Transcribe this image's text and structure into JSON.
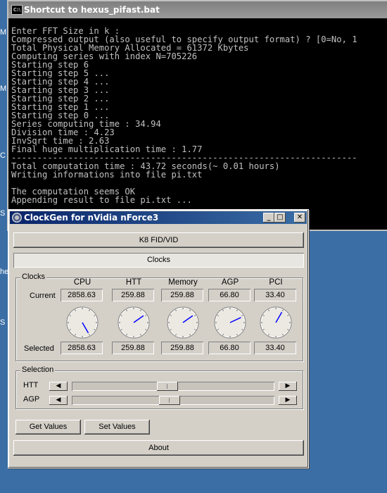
{
  "console": {
    "title": "Shortcut to hexus_pifast.bat",
    "icon_text": "C:\\",
    "lines": [
      "Enter FFT Size in k :",
      "Compressed output (also useful to specify output format) ? [0=No, 1",
      "Total Physical Memory Allocated = 61372 Kbytes",
      "Computing series with index N=705226",
      "Starting step 6",
      "Starting step 5 ...",
      "Starting step 4 ...",
      "Starting step 3 ...",
      "Starting step 2 ...",
      "Starting step 1 ...",
      "Starting step 0 ...",
      "Series computing time : 34.94",
      "Division time : 4.23",
      "InvSqrt time : 2.63",
      "Final huge multiplication time : 1.77",
      "-------------------------------------------------------------------",
      "Total computation time : 43.72 seconds(~ 0.01 hours)",
      "Writing informations into file pi.txt",
      "",
      "The computation seems OK",
      "Appending result to file pi.txt ..."
    ]
  },
  "clockgen": {
    "title": "ClockGen for nVidia nForce3",
    "buttons": {
      "minimize": "_",
      "maximize": "□",
      "close": "✕"
    },
    "tabs": [
      "K8 FID/VID",
      "Clocks"
    ],
    "clocks_group": "Clocks",
    "row_labels": {
      "current": "Current",
      "selected": "Selected"
    },
    "columns": [
      {
        "name": "CPU",
        "current": "2858.63",
        "selected": "2858.63"
      },
      {
        "name": "HTT",
        "current": "259.88",
        "selected": "259.88"
      },
      {
        "name": "Memory",
        "current": "259.88",
        "selected": "259.88"
      },
      {
        "name": "AGP",
        "current": "66.80",
        "selected": "66.80"
      },
      {
        "name": "PCI",
        "current": "33.40",
        "selected": "33.40"
      }
    ],
    "selection_group": "Selection",
    "sliders": [
      {
        "label": "HTT",
        "position": 0.42
      },
      {
        "label": "AGP",
        "position": 0.43
      }
    ],
    "get_values": "Get Values",
    "set_values": "Set Values",
    "about": "About"
  },
  "desktop_fragments": [
    "M",
    "M",
    "C",
    "S",
    "he",
    "S"
  ],
  "colors": {
    "desktop": "#3a6ea5",
    "console_bg": "#000000",
    "console_text": "#c0c0c0",
    "title_active": "#0a246a",
    "needle": "#0000ff"
  }
}
